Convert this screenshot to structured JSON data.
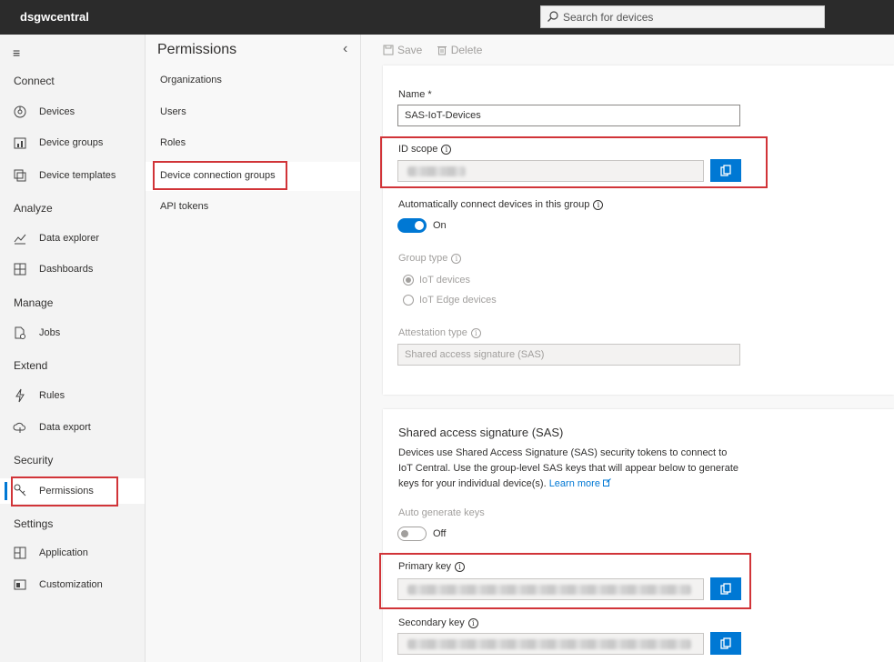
{
  "app": {
    "title": "dsgwcentral"
  },
  "search": {
    "placeholder": "Search for devices"
  },
  "nav": {
    "sections": {
      "connect": "Connect",
      "analyze": "Analyze",
      "manage": "Manage",
      "extend": "Extend",
      "security": "Security",
      "settings": "Settings"
    },
    "items": {
      "devices": "Devices",
      "device_groups": "Device groups",
      "device_templates": "Device templates",
      "data_explorer": "Data explorer",
      "dashboards": "Dashboards",
      "jobs": "Jobs",
      "rules": "Rules",
      "data_export": "Data export",
      "permissions": "Permissions",
      "application": "Application",
      "customization": "Customization"
    }
  },
  "subnav": {
    "title": "Permissions",
    "items": [
      "Organizations",
      "Users",
      "Roles",
      "Device connection groups",
      "API tokens"
    ]
  },
  "toolbar": {
    "save": "Save",
    "delete": "Delete"
  },
  "form": {
    "name_label": "Name *",
    "name_value": "SAS-IoT-Devices",
    "id_scope_label": "ID scope",
    "auto_connect_label": "Automatically connect devices in this group",
    "auto_connect_state": "On",
    "group_type_label": "Group type",
    "group_type_options": [
      "IoT devices",
      "IoT Edge devices"
    ],
    "group_type_selected": "IoT devices",
    "attestation_label": "Attestation type",
    "attestation_value": "Shared access signature (SAS)"
  },
  "sas": {
    "title": "Shared access signature (SAS)",
    "description": "Devices use Shared Access Signature (SAS) security tokens to connect to IoT Central. Use the group-level SAS keys that will appear below to generate keys for your individual device(s).",
    "learn_more": "Learn more",
    "auto_generate_label": "Auto generate keys",
    "auto_generate_state": "Off",
    "primary_key_label": "Primary key",
    "secondary_key_label": "Secondary key"
  },
  "colors": {
    "accent": "#0078d4",
    "highlight": "#d13438",
    "topbar": "#2b2b2b"
  }
}
